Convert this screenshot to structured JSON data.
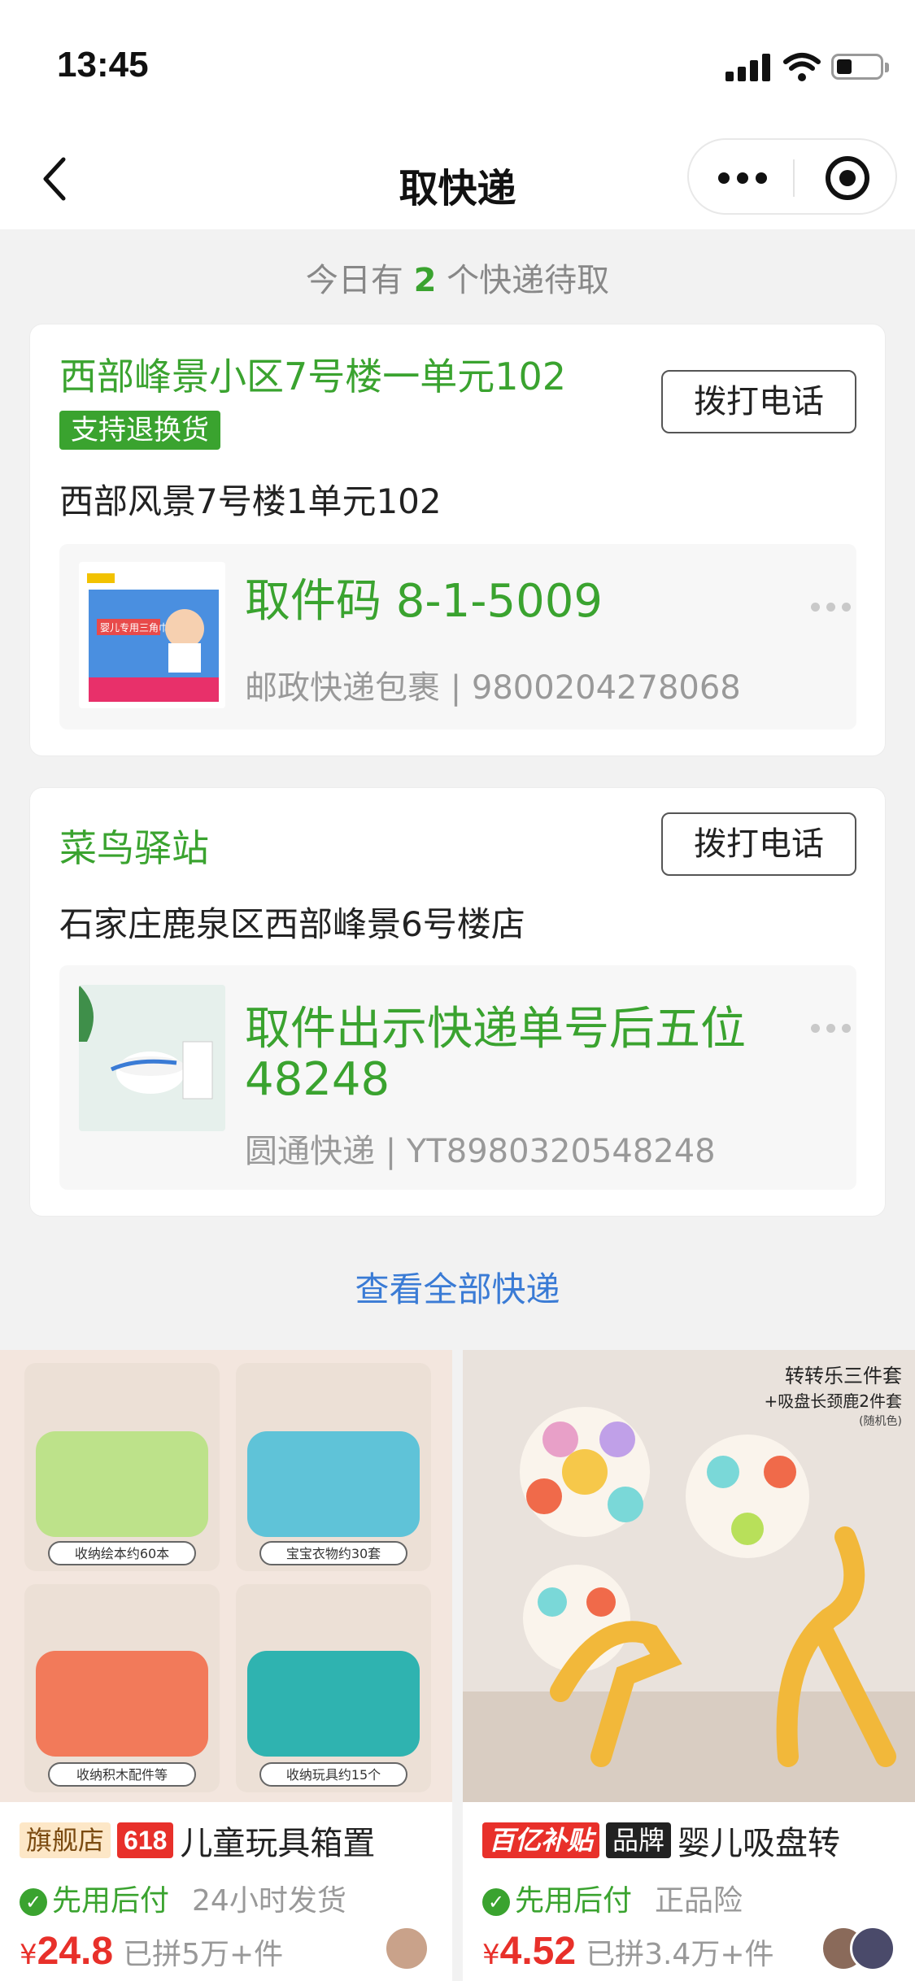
{
  "status_bar": {
    "time": "13:45"
  },
  "nav": {
    "title": "取快递"
  },
  "summary": {
    "prefix": "今日有",
    "count": "2",
    "suffix": "个快递待取"
  },
  "stations": [
    {
      "name": "西部峰景小区7号楼一单元102",
      "tag": "支持退换货",
      "call_label": "拨打电话",
      "address": "西部风景7号楼1单元102",
      "package": {
        "code": "取件码 8-1-5009",
        "meta": "邮政快递包裹 | 9800204278068",
        "thumb_text": "婴儿专用三角巾"
      }
    },
    {
      "name": "菜鸟驿站",
      "call_label": "拨打电话",
      "address": "石家庄鹿泉区西部峰景6号楼店",
      "package": {
        "code": "取件出示快递单号后五位 48248",
        "meta": "圆通快递 | YT8980320548248"
      }
    }
  ],
  "view_all": "查看全部快递",
  "products": [
    {
      "badges": [
        "旗舰店",
        "618"
      ],
      "title": "儿童玩具箱置",
      "perk": "先用后付",
      "perk_extra": "24小时发货",
      "price_symbol": "¥",
      "price": "24.8",
      "sold": "已拼5万+件",
      "image_captions": [
        "收纳绘本约60本",
        "宝宝衣物约30套",
        "收纳积木配件等",
        "收纳玩具约15个"
      ]
    },
    {
      "badges": [
        "百亿补贴",
        "品牌"
      ],
      "title": "婴儿吸盘转",
      "perk": "先用后付",
      "perk_extra": "正品险",
      "price_symbol": "¥",
      "price": "4.52",
      "sold": "已拼3.4万+件",
      "image_captions": [
        "转转乐三件套",
        "+吸盘长颈鹿2件套",
        "(随机色)"
      ]
    }
  ],
  "colors": {
    "accent_green": "#3aa32f",
    "price_red": "#e8302a",
    "link_blue": "#3a7bd5"
  }
}
